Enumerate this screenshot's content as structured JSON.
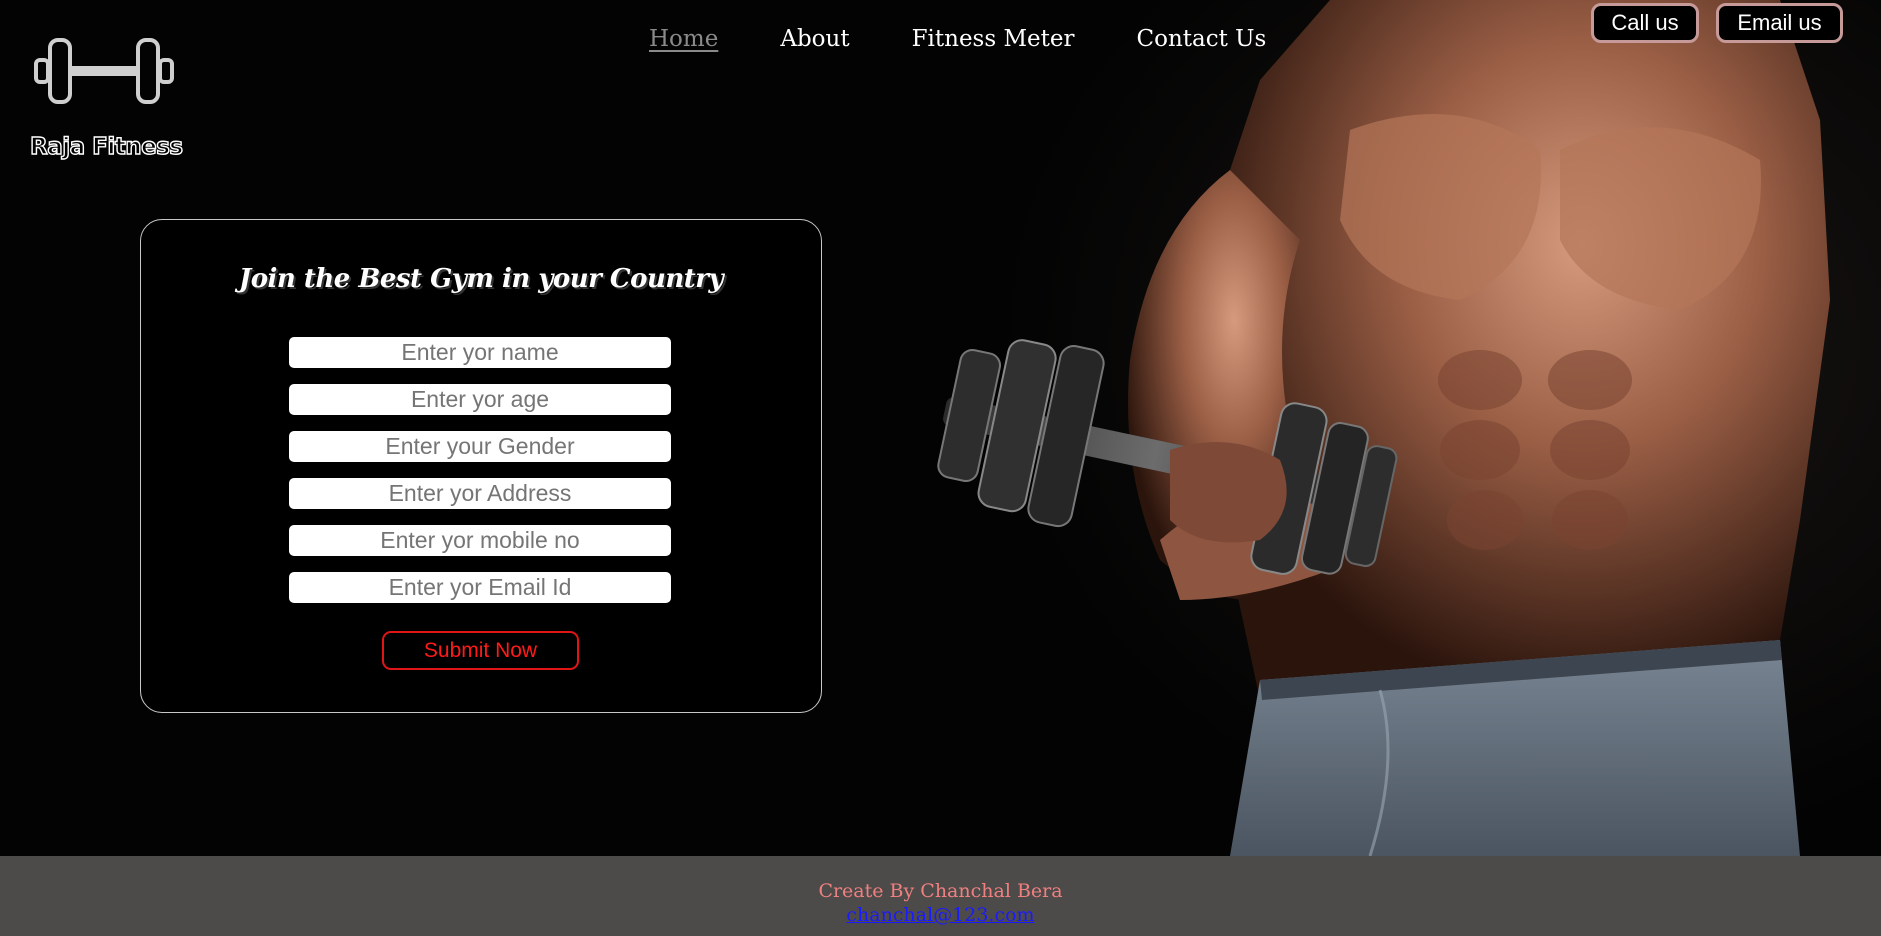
{
  "brand": {
    "name": "Raja Fitness",
    "logo_icon": "dumbbell-icon"
  },
  "nav": {
    "items": [
      {
        "label": "Home",
        "active": true
      },
      {
        "label": "About"
      },
      {
        "label": "Fitness Meter"
      },
      {
        "label": "Contact Us"
      }
    ]
  },
  "contact": {
    "call_label": "Call us",
    "email_label": "Email us"
  },
  "form": {
    "title": "Join the Best Gym in your Country",
    "fields": [
      {
        "placeholder": "Enter yor name",
        "value": ""
      },
      {
        "placeholder": "Enter yor age",
        "value": ""
      },
      {
        "placeholder": "Enter your Gender",
        "value": ""
      },
      {
        "placeholder": "Enter yor Address",
        "value": ""
      },
      {
        "placeholder": "Enter yor mobile no",
        "value": ""
      },
      {
        "placeholder": "Enter yor Email Id",
        "value": ""
      }
    ],
    "submit_label": "Submit Now"
  },
  "footer": {
    "credit": "Create By Chanchal Bera",
    "email": "chanchal@123.com"
  },
  "colors": {
    "background": "#000000",
    "nav_active": "#8a8a8a",
    "contact_border": "#c79a9a",
    "submit": "#ff1a1a",
    "footer_bg": "#4d4a4a",
    "footer_credit": "#f08080",
    "footer_link": "#1a1aff"
  }
}
